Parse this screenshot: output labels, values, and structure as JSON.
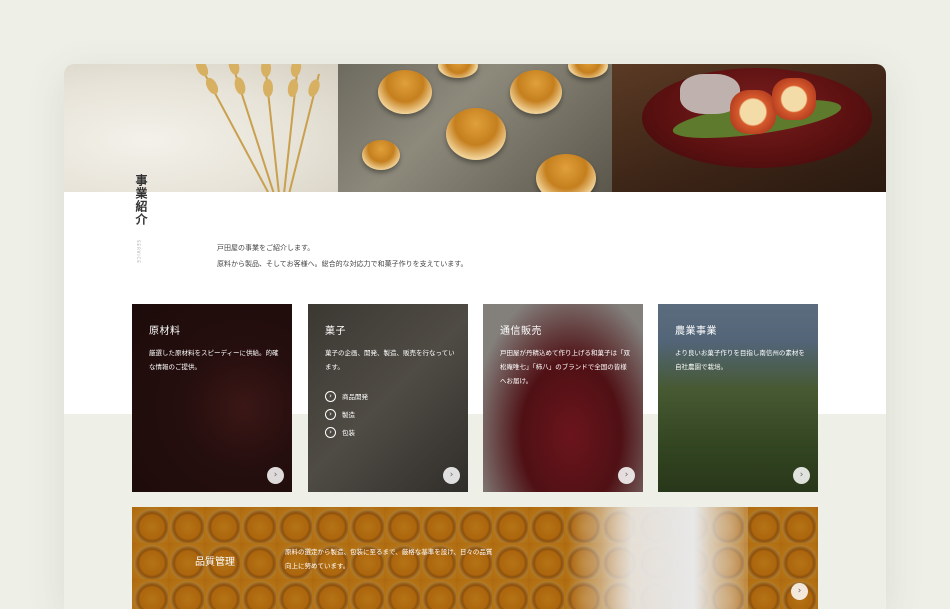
{
  "section": {
    "title": "事業紹介",
    "subtitle": "SERVICE",
    "intro_line1": "戸田屋の事業をご紹介します。",
    "intro_line2": "原料から製品、そしてお客様へ。総合的な対応力で和菓子作りを支えています。"
  },
  "hero": {
    "images": [
      "wheat-flour-image",
      "baked-pastry-image",
      "wagashi-plate-image"
    ]
  },
  "cards": [
    {
      "title": "原材料",
      "desc": "厳選した原材料をスピーディーに供給。的確な情報のご提供。",
      "links": []
    },
    {
      "title": "菓子",
      "desc": "菓子の企画、開発、製造、販売を行なっています。",
      "links": [
        "商品開発",
        "製造",
        "包装"
      ]
    },
    {
      "title": "通信販売",
      "desc": "戸田屋が丹精込めて作り上げる和菓子は「双松庵唯七」「柿八」のブランドで全国の皆様へお届け。",
      "links": []
    },
    {
      "title": "農業事業",
      "desc": "より良いお菓子作りを目指し南信州の素材を自社農園で栽培。",
      "links": []
    }
  ],
  "quality": {
    "title": "品質管理",
    "desc": "原料の選定から製造、包装に至るまで、厳格な基準を設け、日々の品質向上に努めています。"
  },
  "icons": {
    "more": "›",
    "link_arrow": "›"
  },
  "colors": {
    "page_bg": "#eef0e8",
    "band_bg": "#eef0e8",
    "text": "#444444"
  }
}
